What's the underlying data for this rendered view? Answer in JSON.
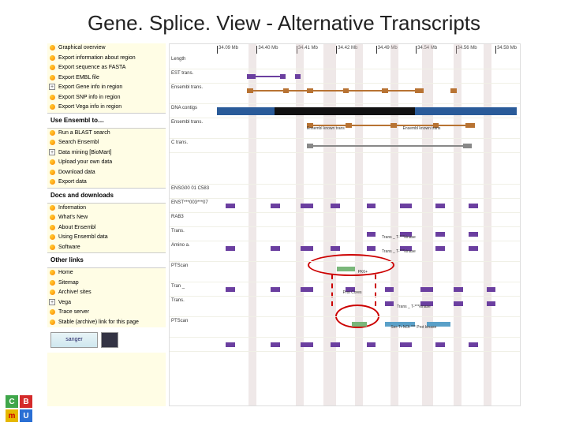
{
  "title": "Gene. Splice. View - Alternative Transcripts",
  "sidebar": {
    "group1": [
      {
        "label": "Graphical overview",
        "kind": "bullet"
      },
      {
        "label": "Export information about region",
        "kind": "bullet"
      },
      {
        "label": "Export sequence as FASTA",
        "kind": "bullet"
      },
      {
        "label": "Export EMBL file",
        "kind": "bullet"
      },
      {
        "label": "Export Gene info in region",
        "kind": "plus"
      },
      {
        "label": "Export SNP info in region",
        "kind": "bullet"
      },
      {
        "label": "Export Vega info in region",
        "kind": "bullet"
      }
    ],
    "header2": "Use Ensembl to…",
    "group2": [
      {
        "label": "Run a BLAST search",
        "kind": "bullet"
      },
      {
        "label": "Search Ensembl",
        "kind": "bullet"
      },
      {
        "label": "Data mining [BioMart]",
        "kind": "plus"
      },
      {
        "label": "Upload your own data",
        "kind": "bullet"
      },
      {
        "label": "Download data",
        "kind": "bullet"
      },
      {
        "label": "Export data",
        "kind": "bullet"
      }
    ],
    "header3": "Docs and downloads",
    "group3": [
      {
        "label": "Information",
        "kind": "bullet"
      },
      {
        "label": "What's New",
        "kind": "bullet"
      },
      {
        "label": "About Ensembl",
        "kind": "bullet"
      },
      {
        "label": "Using Ensembl data",
        "kind": "bullet"
      },
      {
        "label": "Software",
        "kind": "bullet"
      }
    ],
    "header4": "Other links",
    "group4": [
      {
        "label": "Home",
        "kind": "bullet"
      },
      {
        "label": "Sitemap",
        "kind": "bullet"
      },
      {
        "label": "Archive! sites",
        "kind": "bullet"
      },
      {
        "label": "Vega",
        "kind": "plus"
      },
      {
        "label": "Trace server",
        "kind": "bullet"
      },
      {
        "label": "Stable (archive) link for this page",
        "kind": "bullet"
      }
    ],
    "logo_sanger": "sanger",
    "logo_partner": ""
  },
  "ruler": [
    "34.09 Mb",
    "34.40 Mb",
    "34.41 Mb",
    "34.42 Mb",
    "34.49 Mb",
    "34.54 Mb",
    "34.56 Mb",
    "34.58 Mb"
  ],
  "tracks": {
    "length": "Length",
    "est": "EST trans.",
    "ens_trans": "Ensembl trans.",
    "contigs": "DNA contigs",
    "ens_trans2": "Ensembl trans.",
    "cds": "C trans.",
    "gene_id": "ENSG00 01 C583",
    "enst1": "ENST***003***07",
    "rabs": "RAB3",
    "trans": "Trans.",
    "aminoa": "Amino a.",
    "ptscan": "PTScan",
    "tran2": "Tran _",
    "ptscan2": "PTScan",
    "label_a": "Ensembl known trans",
    "label_b": "Ensembl known trans",
    "t_label_1": "Trans _ T-***kinase",
    "t_label_2": "Trans _ T-***kinase",
    "t_label_3": "Trans _ T-***kinase",
    "t_label_4": "Ser-Tr NOt *** Prot kinase",
    "pk1": "PK6+",
    "pk2": "Prot Cores"
  },
  "footer": {
    "c": "C",
    "b": "B",
    "m": "m",
    "u": "U"
  }
}
